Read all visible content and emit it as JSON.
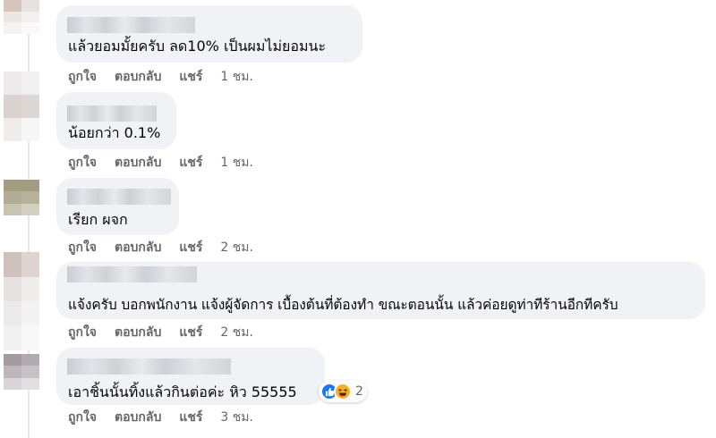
{
  "comments": [
    {
      "text": "แล้วยอมมั้ยครับ ลด10% เป็นผมไม่ยอมนะ",
      "actions": {
        "like": "ถูกใจ",
        "reply": "ตอบกลับ",
        "share": "แชร์",
        "time": "1 ชม."
      }
    },
    {
      "text": "น้อยกว่า 0.1%",
      "actions": {
        "like": "ถูกใจ",
        "reply": "ตอบกลับ",
        "share": "แชร์",
        "time": "1 ชม."
      }
    },
    {
      "text": "เรียก ผจก",
      "actions": {
        "like": "ถูกใจ",
        "reply": "ตอบกลับ",
        "share": "แชร์",
        "time": "2 ชม."
      }
    },
    {
      "text": "แจ้งครับ บอกพนักงาน แจ้งผู้จัดการ เบื้องต้นที่ต้องทำ ขณะตอนนั้น แล้วค่อยดูท่าทีร้านอีกทีครับ",
      "actions": {
        "like": "ถูกใจ",
        "reply": "ตอบกลับ",
        "share": "แชร์",
        "time": "2 ชม."
      }
    },
    {
      "text": "เอาชิ้นนั้นทิ้งแล้วกินต่อค่ะ หิว 55555",
      "actions": {
        "like": "ถูกใจ",
        "reply": "ตอบกลับ",
        "share": "แชร์",
        "time": "3 ชม."
      },
      "reactions": {
        "icons": [
          "like-icon",
          "haha-icon"
        ],
        "count": "2"
      }
    }
  ],
  "colors": {
    "bubble": "#f0f2f5",
    "action_text": "#65676b",
    "like_blue": "#1877f2",
    "haha_yellow": "#f7b125"
  }
}
